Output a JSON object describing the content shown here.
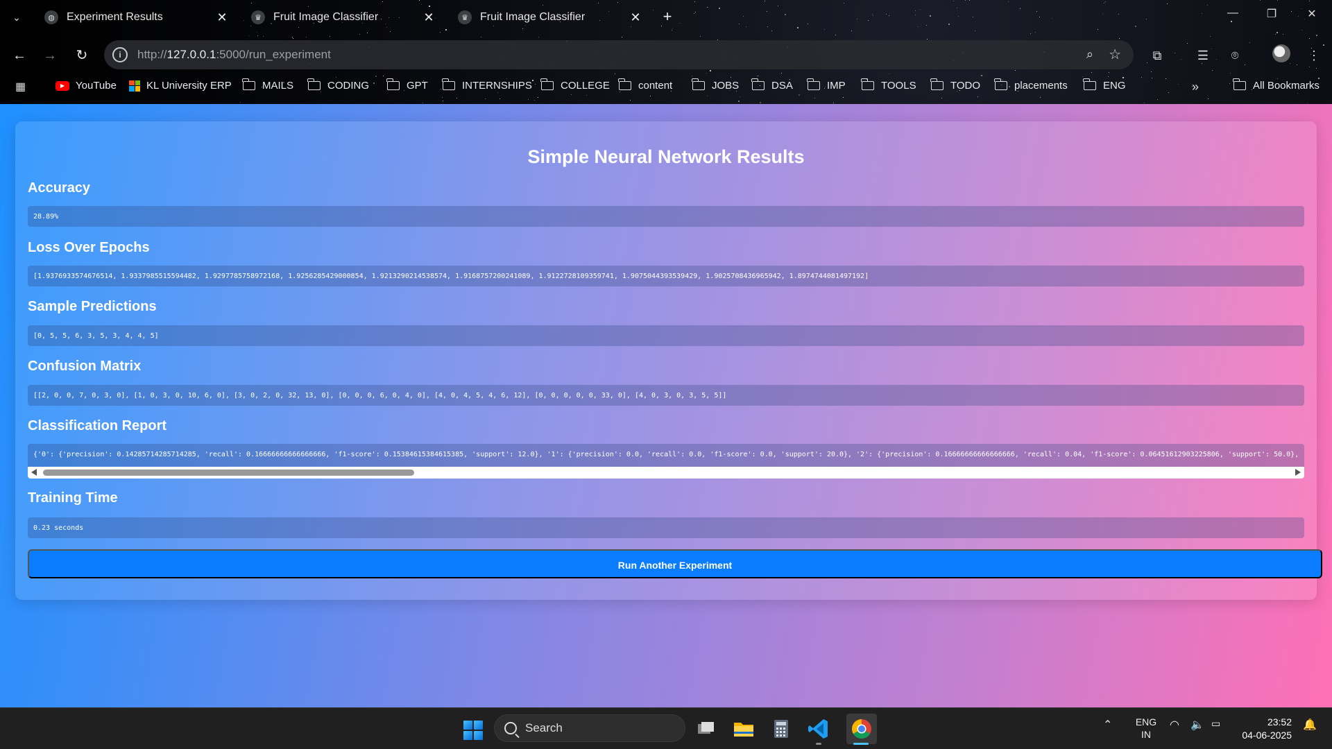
{
  "browser": {
    "tabs": [
      {
        "title": "Experiment Results",
        "icon": "globe-icon",
        "active": true
      },
      {
        "title": "Fruit Image Classifier",
        "icon": "crown-icon",
        "active": false
      },
      {
        "title": "Fruit Image Classifier",
        "icon": "crown-icon",
        "active": false
      }
    ],
    "url_prefix": "http://",
    "url_host": "127.0.0.1",
    "url_rest": ":5000/run_experiment",
    "bookmarks": [
      {
        "label": "YouTube",
        "icon": "youtube-icon"
      },
      {
        "label": "KL University ERP",
        "icon": "microsoft-icon"
      },
      {
        "label": "MAILS",
        "icon": "folder-icon"
      },
      {
        "label": "CODING",
        "icon": "folder-icon"
      },
      {
        "label": "GPT",
        "icon": "folder-icon"
      },
      {
        "label": "INTERNSHIPS",
        "icon": "folder-icon"
      },
      {
        "label": "COLLEGE",
        "icon": "folder-icon"
      },
      {
        "label": "content",
        "icon": "folder-icon"
      },
      {
        "label": "JOBS",
        "icon": "folder-icon"
      },
      {
        "label": "DSA",
        "icon": "folder-icon"
      },
      {
        "label": "IMP",
        "icon": "folder-icon"
      },
      {
        "label": "TOOLS",
        "icon": "folder-icon"
      },
      {
        "label": "TODO",
        "icon": "folder-icon"
      },
      {
        "label": "placements",
        "icon": "folder-icon"
      },
      {
        "label": "ENG",
        "icon": "folder-icon"
      }
    ],
    "all_bookmarks": "All Bookmarks"
  },
  "page": {
    "title": "Simple Neural Network Results",
    "sections": {
      "accuracy": {
        "label": "Accuracy",
        "value": "28.89%"
      },
      "loss": {
        "label": "Loss Over Epochs",
        "value": "[1.9376933574676514, 1.9337985515594482, 1.9297785758972168, 1.9256285429000854, 1.9213290214538574, 1.9168757200241089, 1.9122728109359741, 1.9075044393539429, 1.9025708436965942, 1.8974744081497192]"
      },
      "predictions": {
        "label": "Sample Predictions",
        "value": "[0, 5, 5, 6, 3, 5, 3, 4, 4, 5]"
      },
      "confusion": {
        "label": "Confusion Matrix",
        "value": "[[2, 0, 0, 7, 0, 3, 0], [1, 0, 3, 0, 10, 6, 0], [3, 0, 2, 0, 32, 13, 0], [0, 0, 0, 6, 0, 4, 0], [4, 0, 4, 5, 4, 6, 12], [0, 0, 0, 0, 0, 33, 0], [4, 0, 3, 0, 3, 5, 5]]"
      },
      "report": {
        "label": "Classification Report",
        "value": "{'0': {'precision': 0.14285714285714285, 'recall': 0.16666666666666666, 'f1-score': 0.15384615384615385, 'support': 12.0}, '1': {'precision': 0.0, 'recall': 0.0, 'f1-score': 0.0, 'support': 20.0}, '2': {'precision': 0.16666666666666666, 'recall': 0.04, 'f1-score': 0.06451612903225806, 'support': 50.0}, '3':"
      },
      "time": {
        "label": "Training Time",
        "value": "0.23 seconds"
      }
    },
    "run_button": "Run Another Experiment"
  },
  "taskbar": {
    "search_label": "Search",
    "lang_top": "ENG",
    "lang_bottom": "IN",
    "time": "23:52",
    "date": "04-06-2025"
  },
  "colors": {
    "accent_button": "#0a7cff",
    "gradient_start": "#1e90ff",
    "gradient_end": "#ff6fb5"
  }
}
